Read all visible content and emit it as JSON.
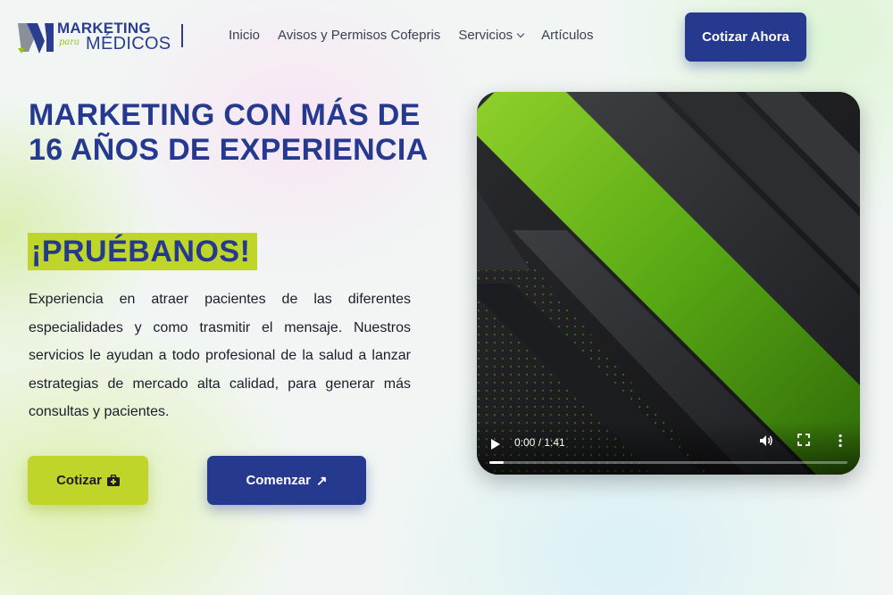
{
  "header": {
    "logo": {
      "line1": "MARKETING",
      "script": "para",
      "line2": "MÉDICOS"
    },
    "nav": [
      {
        "label": "Inicio"
      },
      {
        "label": "Avisos y Permisos Cofepris"
      },
      {
        "label": "Servicios",
        "has_dropdown": true
      },
      {
        "label": "Artículos"
      }
    ],
    "cta_label": "Cotizar Ahora"
  },
  "hero": {
    "title": "MARKETING CON MÁS DE 16 AÑOS DE EXPERIENCIA",
    "highlight": "¡PRUÉBANOS!",
    "description": "Experiencia en atraer pacientes de las diferentes especialidades y como trasmitir el mensaje. Nuestros servicios le ayudan a todo profesional de la salud a lanzar estrategias de mercado alta calidad, para generar más consultas y pacientes.",
    "buttons": {
      "primary_label": "Cotizar",
      "primary_icon": "medical-kit-icon",
      "secondary_label": "Comenzar",
      "secondary_icon": "↗"
    }
  },
  "video": {
    "time_display": "0:00 / 1:41",
    "progress_fraction": 0.04,
    "icons": [
      "play-icon",
      "volume-icon",
      "fullscreen-icon",
      "more-options-icon"
    ]
  },
  "colors": {
    "brand_blue": "#25398f",
    "brand_lime": "#bfd52a",
    "video_green": "#6bbf1a"
  }
}
